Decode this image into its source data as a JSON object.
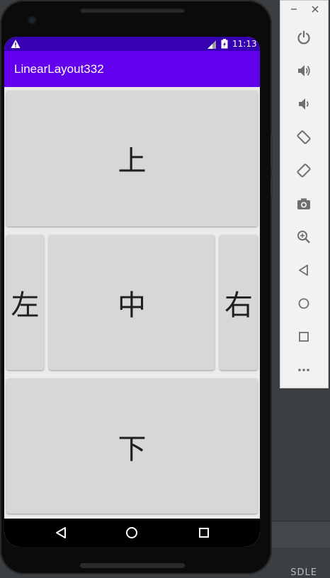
{
  "status_bar": {
    "time": "11:13",
    "colors": {
      "background": "#3700b3"
    },
    "icons": [
      "warning-icon",
      "signal-icon",
      "battery-icon"
    ]
  },
  "app_bar": {
    "title": "LinearLayout332",
    "color": "#6200ee"
  },
  "buttons": {
    "up": "上",
    "left": "左",
    "center": "中",
    "right": "右",
    "down": "下"
  },
  "nav_bar": {
    "icons": [
      "back-icon",
      "home-icon",
      "recents-icon"
    ]
  },
  "emulator_toolbar": {
    "window_controls": {
      "minimize": "−",
      "close": "×"
    },
    "tools": [
      "power-icon",
      "volume-up-icon",
      "volume-down-icon",
      "rotate-left-icon",
      "rotate-right-icon",
      "camera-icon",
      "zoom-icon",
      "back-icon",
      "home-icon",
      "overview-icon",
      "more-icon"
    ]
  },
  "ide": {
    "status_text": "SDLE"
  }
}
